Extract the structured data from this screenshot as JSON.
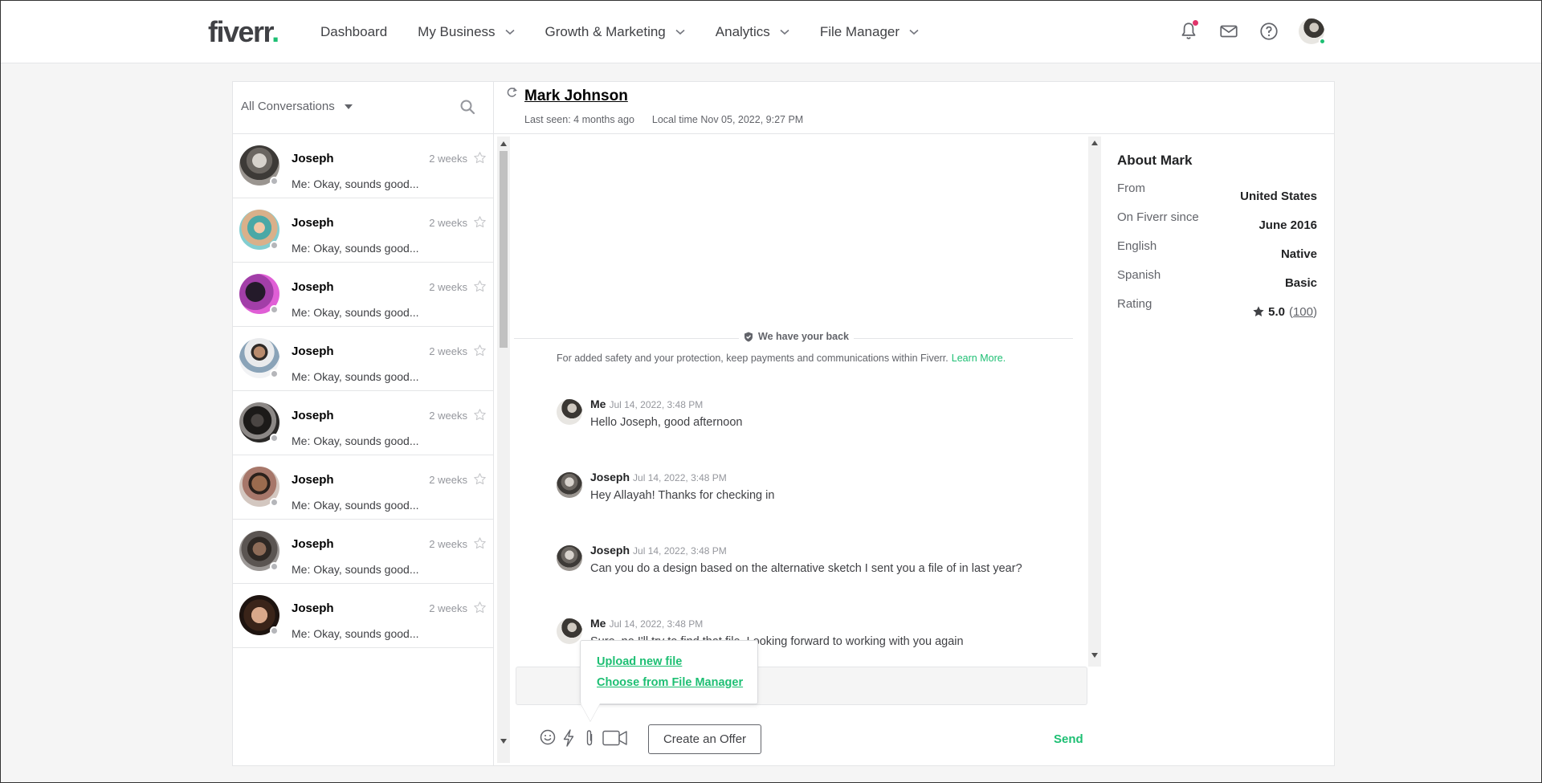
{
  "header": {
    "logo_text": "fiverr",
    "logo_dot": ".",
    "nav": [
      {
        "label": "Dashboard",
        "dropdown": false
      },
      {
        "label": "My Business",
        "dropdown": true
      },
      {
        "label": "Growth & Marketing",
        "dropdown": true
      },
      {
        "label": "Analytics",
        "dropdown": true
      },
      {
        "label": "File Manager",
        "dropdown": true
      }
    ],
    "icons": [
      "bell-icon",
      "mail-icon",
      "help-icon"
    ],
    "colors": {
      "brand_green": "#1dbf73",
      "notification_dot": "#e0336a"
    }
  },
  "conversations": {
    "filter_label": "All Conversations",
    "items": [
      {
        "name": "Joseph",
        "time": "2 weeks",
        "snippet": "Me: Okay, sounds good..."
      },
      {
        "name": "Joseph",
        "time": "2 weeks",
        "snippet": "Me: Okay, sounds good..."
      },
      {
        "name": "Joseph",
        "time": "2 weeks",
        "snippet": "Me: Okay, sounds good..."
      },
      {
        "name": "Joseph",
        "time": "2 weeks",
        "snippet": "Me: Okay, sounds good..."
      },
      {
        "name": "Joseph",
        "time": "2 weeks",
        "snippet": "Me: Okay, sounds good..."
      },
      {
        "name": "Joseph",
        "time": "2 weeks",
        "snippet": "Me: Okay, sounds good..."
      },
      {
        "name": "Joseph",
        "time": "2 weeks",
        "snippet": "Me: Okay, sounds good..."
      },
      {
        "name": "Joseph",
        "time": "2 weeks",
        "snippet": "Me: Okay, sounds good..."
      }
    ]
  },
  "chat": {
    "contact_name": "Mark Johnson",
    "last_seen": "Last seen: 4 months ago",
    "local_time": "Local time Nov 05, 2022, 9:27 PM",
    "safety_title": "We have your back",
    "safety_text": "For added safety and your protection, keep payments and communications within Fiverr.",
    "safety_link": "Learn More.",
    "messages": [
      {
        "author": "Me",
        "time": "Jul 14, 2022, 3:48 PM",
        "text": "Hello Joseph, good afternoon"
      },
      {
        "author": "Joseph",
        "time": "Jul 14, 2022, 3:48 PM",
        "text": "Hey Allayah! Thanks for checking in"
      },
      {
        "author": "Joseph",
        "time": "Jul 14, 2022, 3:48 PM",
        "text": "Can you do a design based on the alternative sketch I sent you a file of in last year?"
      },
      {
        "author": "Me",
        "time": "Jul 14, 2022, 3:48 PM",
        "text": "Sure, no I'll try to find that file. Looking forward to working with you again"
      }
    ],
    "attach_menu": {
      "upload": "Upload new file",
      "choose": "Choose from File Manager"
    },
    "create_offer": "Create an Offer",
    "send": "Send"
  },
  "about": {
    "title": "About Mark",
    "rows": [
      {
        "key": "From",
        "value": "United States"
      },
      {
        "key": "On Fiverr since",
        "value": "June 2016"
      },
      {
        "key": "English",
        "value": "Native"
      },
      {
        "key": "Spanish",
        "value": "Basic"
      }
    ],
    "rating_label": "Rating",
    "rating_value": "5.0",
    "rating_count": "100"
  }
}
